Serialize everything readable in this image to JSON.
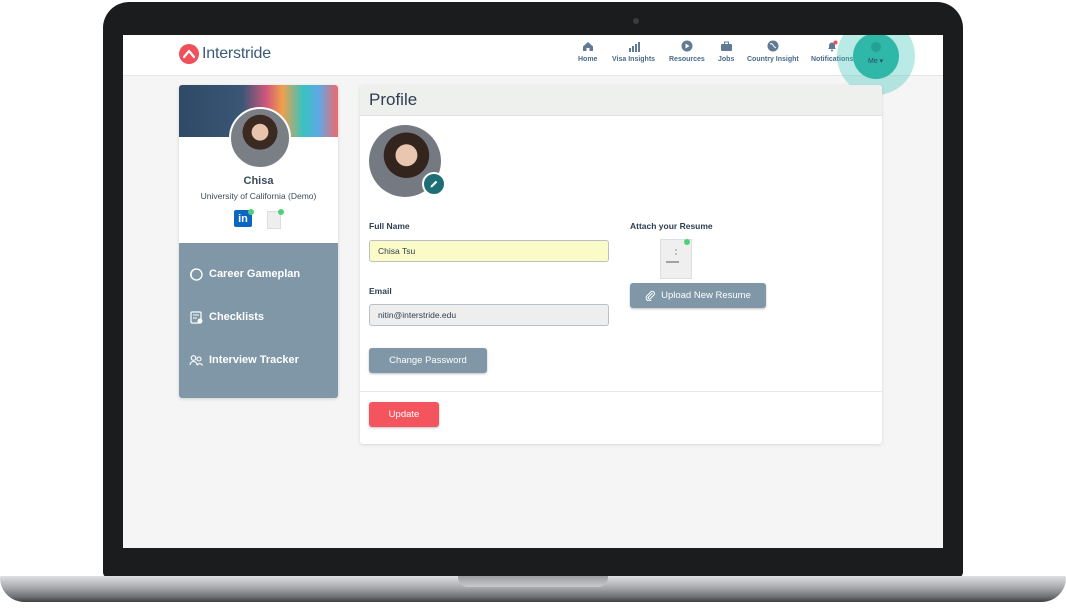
{
  "app": {
    "logo_text": "Interstride",
    "brand_color": "#f0505a",
    "accent_color": "#2fb7a8"
  },
  "nav": {
    "items": [
      {
        "label": "Home",
        "icon": "home-icon"
      },
      {
        "label": "Visa Insights",
        "icon": "bar-chart-icon"
      },
      {
        "label": "Resources",
        "icon": "play-icon"
      },
      {
        "label": "Jobs",
        "icon": "briefcase-icon"
      },
      {
        "label": "Country Insight",
        "icon": "globe-icon"
      },
      {
        "label": "Notifications",
        "icon": "bell-icon"
      }
    ],
    "me_label": "Me ▾"
  },
  "sidebar": {
    "name": "Chisa",
    "school": "University of California (Demo)",
    "linkedin_text": "in",
    "items": [
      {
        "label": "Career Gameplan",
        "icon": "gameplan-icon"
      },
      {
        "label": "Checklists",
        "icon": "checklist-icon"
      },
      {
        "label": "Interview Tracker",
        "icon": "people-icon"
      }
    ]
  },
  "profile": {
    "title": "Profile",
    "full_name_label": "Full Name",
    "full_name_value": "Chisa Tsu",
    "email_label": "Email",
    "email_value": "nitin@interstride.edu",
    "resume_label": "Attach your Resume",
    "upload_button": "Upload New Resume",
    "change_password_button": "Change Password",
    "update_button": "Update"
  }
}
